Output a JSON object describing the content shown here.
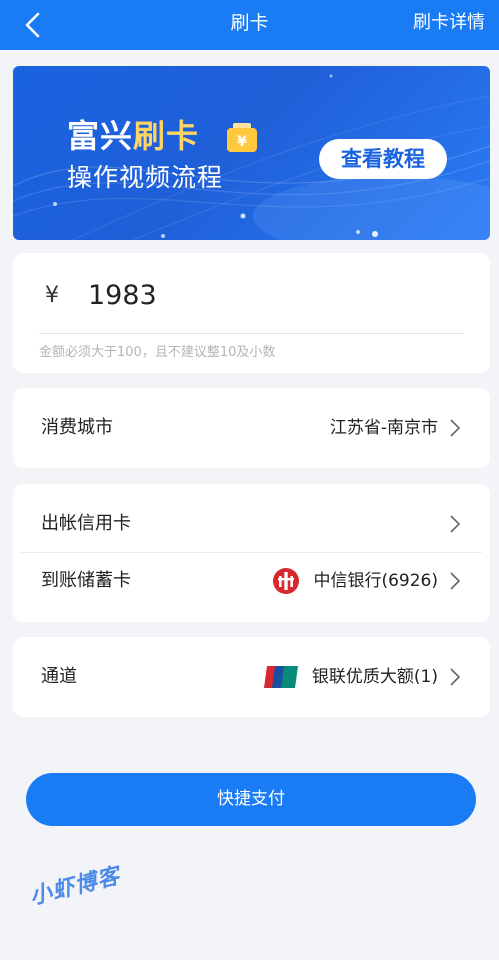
{
  "header": {
    "title": "刷卡",
    "detail_label": "刷卡详情"
  },
  "banner": {
    "title_prefix": "富兴",
    "title_highlight": "刷卡",
    "subtitle": "操作视频流程",
    "button_label": "查看教程"
  },
  "amount": {
    "currency_symbol": "¥",
    "value": "1983",
    "hint": "金额必须大于100，且不建议整10及小数"
  },
  "city": {
    "label": "消费城市",
    "value": "江苏省-南京市"
  },
  "cards": {
    "credit_label": "出帐信用卡",
    "credit_value": "",
    "debit_label": "到账储蓄卡",
    "debit_value": "中信银行(6926)"
  },
  "channel": {
    "label": "通道",
    "value": "银联优质大额(1)"
  },
  "pay_button": "快捷支付",
  "watermark": "小虾博客",
  "colors": {
    "primary": "#1a7cf5",
    "bank_red": "#d7282f",
    "background": "#f3f4f8"
  }
}
